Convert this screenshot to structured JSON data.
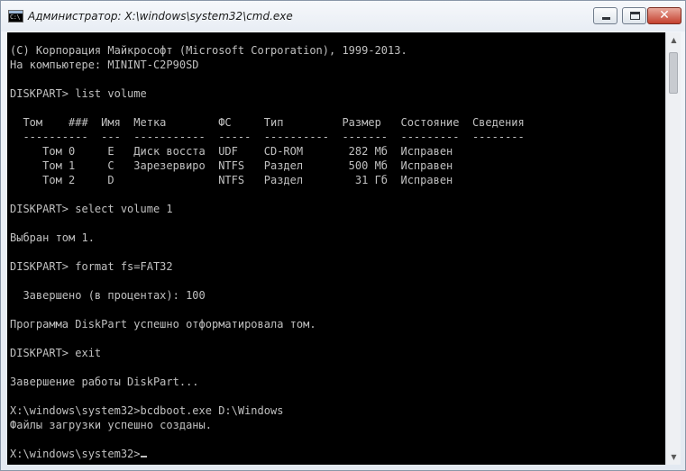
{
  "window": {
    "title": "Администратор: X:\\windows\\system32\\cmd.exe",
    "app_icon_text": "C:\\",
    "controls": {
      "minimize": "minimize-icon",
      "maximize": "maximize-icon",
      "close": "✕"
    }
  },
  "console": {
    "lines": [
      "(C) Корпорация Майкрософт (Microsoft Corporation), 1999-2013.",
      "На компьютере: MININT-C2P90SD",
      "",
      "DISKPART> list volume",
      "",
      "  Том    ###  Имя  Метка        ФС     Тип         Размер   Состояние  Сведения",
      "  ----------  ---  -----------  -----  ----------  -------  ---------  --------",
      "     Том 0     E   Диск восста  UDF    CD-ROM       282 Мб  Исправен",
      "     Том 1     C   Зарезервиро  NTFS   Раздел       500 Мб  Исправен",
      "     Том 2     D                NTFS   Раздел        31 Гб  Исправен",
      "",
      "DISKPART> select volume 1",
      "",
      "Выбран том 1.",
      "",
      "DISKPART> format fs=FAT32",
      "",
      "  Завершено (в процентах): 100",
      "",
      "Программа DiskPart успешно отформатировала том.",
      "",
      "DISKPART> exit",
      "",
      "Завершение работы DiskPart...",
      "",
      "X:\\windows\\system32>bcdboot.exe D:\\Windows",
      "Файлы загрузки успешно созданы.",
      "",
      "X:\\windows\\system32>"
    ]
  },
  "scrollbar": {
    "up_arrow": "▲",
    "down_arrow": "▼"
  }
}
